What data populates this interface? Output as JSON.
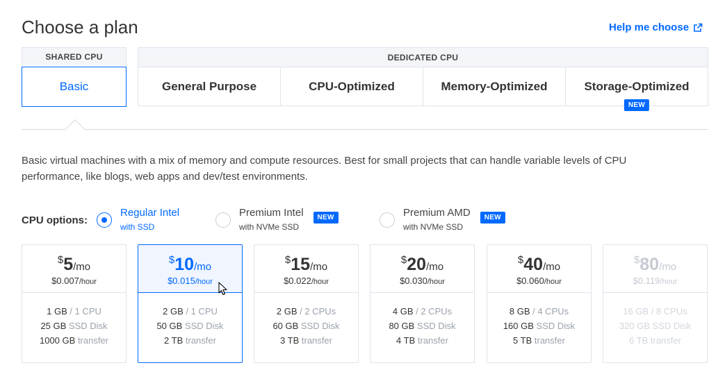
{
  "page": {
    "title": "Choose a plan",
    "help_link": "Help me choose"
  },
  "categories": {
    "shared_label": "SHARED CPU",
    "dedicated_label": "DEDICATED CPU",
    "tabs": [
      {
        "label": "Basic",
        "active": true
      },
      {
        "label": "General Purpose"
      },
      {
        "label": "CPU-Optimized"
      },
      {
        "label": "Memory-Optimized"
      },
      {
        "label": "Storage-Optimized",
        "badge": "NEW"
      }
    ]
  },
  "description": "Basic virtual machines with a mix of memory and compute resources. Best for small projects that can handle variable levels of CPU performance, like blogs, web apps and dev/test environments.",
  "cpu_options": {
    "label": "CPU options:",
    "options": [
      {
        "line1": "Regular Intel",
        "line2": "with SSD",
        "selected": true
      },
      {
        "line1": "Premium Intel",
        "line2": "with NVMe SSD",
        "badge": "NEW"
      },
      {
        "line1": "Premium AMD",
        "line2": "with NVMe SSD",
        "badge": "NEW"
      }
    ]
  },
  "plans": [
    {
      "currency": "$",
      "amount": "5",
      "per": "/mo",
      "hourly": "$0.007",
      "hour_unit": "/hour",
      "mem": "1 GB",
      "cpu": "/ 1 CPU",
      "disk": "25 GB",
      "disk_unit": "SSD Disk",
      "transfer": "1000 GB",
      "transfer_unit": "transfer"
    },
    {
      "currency": "$",
      "amount": "10",
      "per": "/mo",
      "hourly": "$0.015",
      "hour_unit": "/hour",
      "mem": "2 GB",
      "cpu": "/ 1 CPU",
      "disk": "50 GB",
      "disk_unit": "SSD Disk",
      "transfer": "2 TB",
      "transfer_unit": "transfer",
      "selected": true
    },
    {
      "currency": "$",
      "amount": "15",
      "per": "/mo",
      "hourly": "$0.022",
      "hour_unit": "/hour",
      "mem": "2 GB",
      "cpu": "/ 2 CPUs",
      "disk": "60 GB",
      "disk_unit": "SSD Disk",
      "transfer": "3 TB",
      "transfer_unit": "transfer"
    },
    {
      "currency": "$",
      "amount": "20",
      "per": "/mo",
      "hourly": "$0.030",
      "hour_unit": "/hour",
      "mem": "4 GB",
      "cpu": "/ 2 CPUs",
      "disk": "80 GB",
      "disk_unit": "SSD Disk",
      "transfer": "4 TB",
      "transfer_unit": "transfer"
    },
    {
      "currency": "$",
      "amount": "40",
      "per": "/mo",
      "hourly": "$0.060",
      "hour_unit": "/hour",
      "mem": "8 GB",
      "cpu": "/ 4 CPUs",
      "disk": "160 GB",
      "disk_unit": "SSD Disk",
      "transfer": "5 TB",
      "transfer_unit": "transfer"
    },
    {
      "currency": "$",
      "amount": "80",
      "per": "/mo",
      "hourly": "$0.119",
      "hour_unit": "/hour",
      "mem": "16 GB",
      "cpu": "/ 8 CPUs",
      "disk": "320 GB",
      "disk_unit": "SSD Disk",
      "transfer": "6 TB",
      "transfer_unit": "transfer",
      "disabled": true
    }
  ],
  "colors": {
    "accent": "#0069ff",
    "border": "#dfe3eb",
    "header_bg": "#f3f5f9",
    "selected_bg": "#f0f5ff"
  }
}
